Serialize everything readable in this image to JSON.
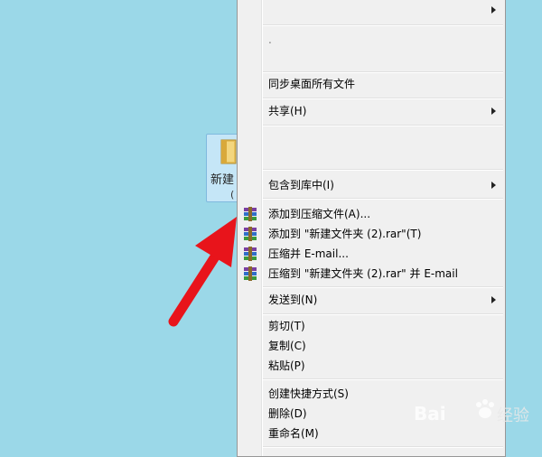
{
  "desktop_icon": {
    "label": "新建",
    "sub": "("
  },
  "menu": {
    "items": [
      {
        "label": "",
        "submenu": true,
        "icon": ""
      },
      {
        "label": ".",
        "submenu": false,
        "icon": ""
      },
      {
        "label": "同步桌面所有文件",
        "submenu": false,
        "icon": ""
      },
      {
        "label": "共享(H)",
        "submenu": true,
        "icon": ""
      },
      {
        "label": "包含到库中(I)",
        "submenu": true,
        "icon": ""
      },
      {
        "label": "添加到压缩文件(A)...",
        "submenu": false,
        "icon": "winrar-icon"
      },
      {
        "label": "添加到 \"新建文件夹 (2).rar\"(T)",
        "submenu": false,
        "icon": "winrar-icon"
      },
      {
        "label": "压缩并 E-mail...",
        "submenu": false,
        "icon": "winrar-icon"
      },
      {
        "label": "压缩到 \"新建文件夹 (2).rar\" 并 E-mail",
        "submenu": false,
        "icon": "winrar-icon"
      },
      {
        "label": "发送到(N)",
        "submenu": true,
        "icon": ""
      },
      {
        "label": "剪切(T)",
        "submenu": false,
        "icon": ""
      },
      {
        "label": "复制(C)",
        "submenu": false,
        "icon": ""
      },
      {
        "label": "粘贴(P)",
        "submenu": false,
        "icon": ""
      },
      {
        "label": "创建快捷方式(S)",
        "submenu": false,
        "icon": ""
      },
      {
        "label": "删除(D)",
        "submenu": false,
        "icon": ""
      },
      {
        "label": "重命名(M)",
        "submenu": false,
        "icon": ""
      }
    ]
  },
  "watermark": {
    "text": "Bai",
    "sub": "经验"
  },
  "colors": {
    "arrow": "#e8141b",
    "desktop": "#9bd8e8",
    "menu_bg": "#f0f0f0"
  }
}
